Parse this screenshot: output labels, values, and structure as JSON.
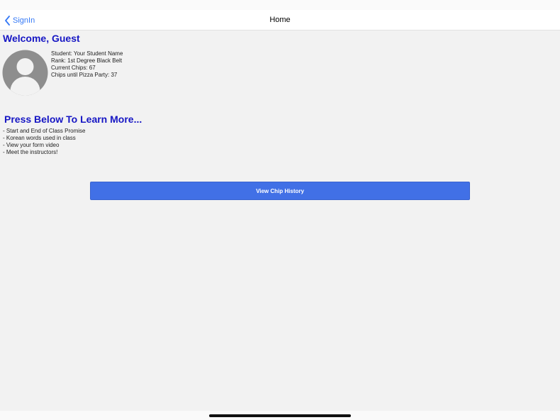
{
  "nav": {
    "back_label": "SignIn",
    "title": "Home"
  },
  "welcome": {
    "text": "Welcome, Guest"
  },
  "student": {
    "name_line": "Student: Your Student Name",
    "rank_line": "Rank: 1st Degree Black Belt",
    "chips_line": "Current Chips: 67",
    "pizza_line": "Chips until Pizza Party: 37"
  },
  "learn": {
    "heading": "Press Below To Learn More...",
    "items": [
      "- Start and End of Class Promise",
      "- Korean words used in class",
      "- View your form video",
      "- Meet the instructors!"
    ]
  },
  "actions": {
    "chip_history_label": "View Chip History"
  },
  "colors": {
    "accent_blue": "#3478f6",
    "heading_blue": "#1616c4",
    "button_blue": "#4170e6",
    "background": "#f2f2f2"
  },
  "icons": {
    "back": "chevron-left-icon",
    "avatar": "user-avatar-icon"
  }
}
